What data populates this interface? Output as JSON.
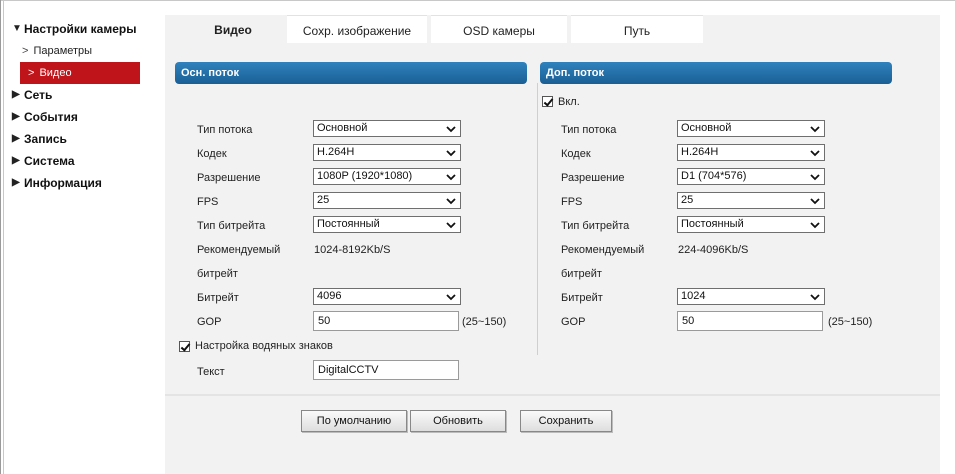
{
  "sidebar": {
    "camera_settings": "Настройки камеры",
    "params": "Параметры",
    "video": "Видео",
    "network": "Сеть",
    "events": "События",
    "record": "Запись",
    "system": "Система",
    "info": "Информация"
  },
  "tabs": {
    "video": "Видео",
    "save_image": "Сохр. изображение",
    "osd": "OSD камеры",
    "path": "Путь"
  },
  "main_stream": {
    "title": "Осн. поток",
    "stream_type_label": "Тип потока",
    "stream_type": "Основной",
    "codec_label": "Кодек",
    "codec": "H.264H",
    "resolution_label": "Разрешение",
    "resolution": "1080P (1920*1080)",
    "fps_label": "FPS",
    "fps": "25",
    "bitrate_type_label": "Тип битрейта",
    "bitrate_type": "Постоянный",
    "recommended_label_1": "Рекомендуемый",
    "recommended_label_2": "битрейт",
    "recommended_value": "1024-8192Kb/S",
    "bitrate_label": "Битрейт",
    "bitrate": "4096",
    "gop_label": "GOP",
    "gop": "50",
    "gop_range": "(25~150)"
  },
  "sub_stream": {
    "title": "Доп. поток",
    "enable_label": "Вкл.",
    "stream_type_label": "Тип потока",
    "stream_type": "Основной",
    "codec_label": "Кодек",
    "codec": "H.264H",
    "resolution_label": "Разрешение",
    "resolution": "D1 (704*576)",
    "fps_label": "FPS",
    "fps": "25",
    "bitrate_type_label": "Тип битрейта",
    "bitrate_type": "Постоянный",
    "recommended_label_1": "Рекомендуемый",
    "recommended_label_2": "битрейт",
    "recommended_value": "224-4096Kb/S",
    "bitrate_label": "Битрейт",
    "bitrate": "1024",
    "gop_label": "GOP",
    "gop": "50",
    "gop_range": "(25~150)"
  },
  "watermark": {
    "enable_label": "Настройка водяных знаков",
    "text_label": "Текст",
    "text_value": "DigitalCCTV"
  },
  "buttons": {
    "default": "По умолчанию",
    "refresh": "Обновить",
    "save": "Сохранить"
  }
}
